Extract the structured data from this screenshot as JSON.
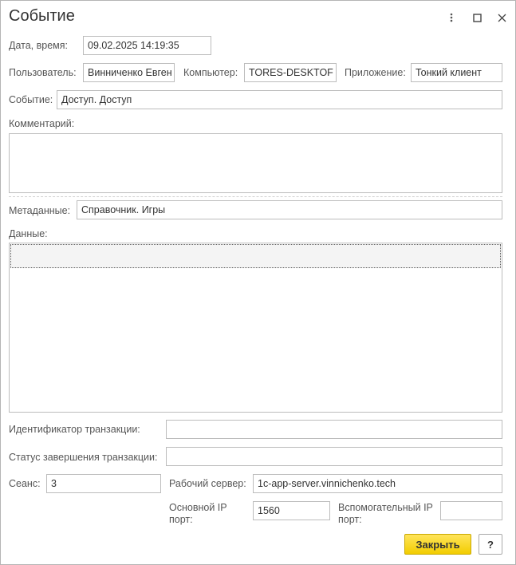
{
  "window": {
    "title": "Событие",
    "more_icon": "vertical-dots-icon",
    "maximize_icon": "square-icon",
    "close_icon": "close-icon"
  },
  "form": {
    "datetime_label": "Дата, время:",
    "datetime_value": "09.02.2025 14:19:35",
    "user_label": "Пользователь:",
    "user_value": "Винниченко Евген",
    "computer_label": "Компьютер:",
    "computer_value": "TORES-DESKTOF",
    "app_label": "Приложение:",
    "app_value": "Тонкий клиент",
    "event_label": "Событие:",
    "event_value": "Доступ. Доступ",
    "comment_label": "Комментарий:",
    "comment_value": "",
    "metadata_label": "Метаданные:",
    "metadata_value": "Справочник. Игры",
    "data_label": "Данные:",
    "transaction_id_label": "Идентификатор транзакции:",
    "transaction_id_value": "",
    "transaction_status_label": "Статус завершения транзакции:",
    "transaction_status_value": "",
    "session_label": "Сеанс:",
    "session_value": "3",
    "server_label": "Рабочий сервер:",
    "server_value": "1c-app-server.vinnichenko.tech",
    "main_port_label_1": "Основной IP",
    "main_port_label_2": "порт:",
    "main_port_value": "1560",
    "aux_port_label_1": "Вспомогательный IP",
    "aux_port_label_2": "порт:",
    "aux_port_value": ""
  },
  "footer": {
    "close_label": "Закрыть",
    "help_label": "?"
  }
}
